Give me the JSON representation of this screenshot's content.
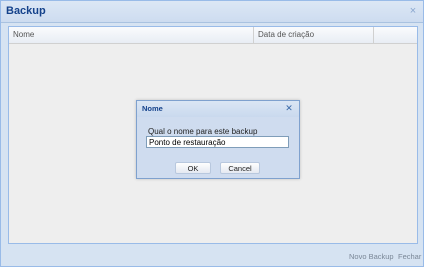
{
  "window": {
    "title": "Backup",
    "close_glyph": "×"
  },
  "grid": {
    "columns": [
      "Nome",
      "Data de criação",
      ""
    ]
  },
  "footer": {
    "new_backup_label": "Novo Backup",
    "close_label": "Fechar"
  },
  "dialog": {
    "title": "Nome",
    "close_glyph": "✕",
    "prompt": "Qual o nome para este backup",
    "input_value": "Ponto de restauração",
    "ok_label": "OK",
    "cancel_label": "Cancel"
  },
  "colors": {
    "title_text": "#15428b",
    "panel_bg": "#d6e3f2",
    "border": "#99bbe8"
  }
}
